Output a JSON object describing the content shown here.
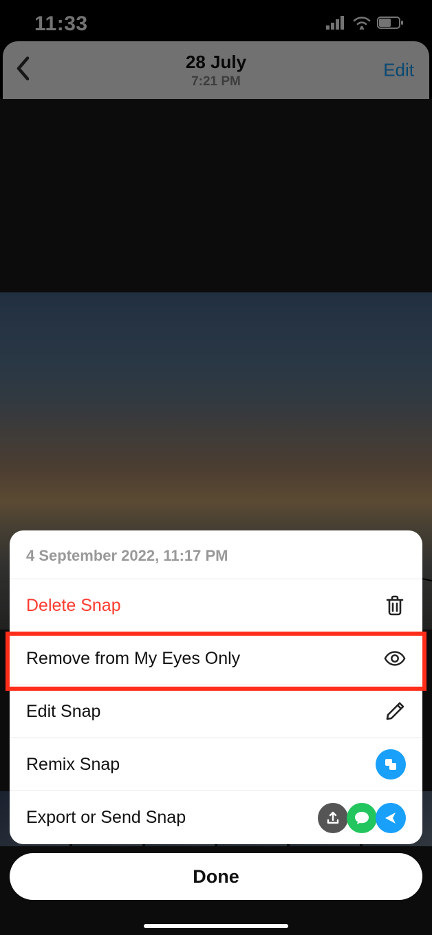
{
  "statusbar": {
    "time": "11:33"
  },
  "header": {
    "date": "28 July",
    "time": "7:21 PM",
    "edit": "Edit"
  },
  "sheet": {
    "timestamp": "4 September 2022, 11:17 PM",
    "rows": {
      "delete": {
        "label": "Delete Snap"
      },
      "remove": {
        "label": "Remove from My Eyes Only"
      },
      "edit": {
        "label": "Edit Snap"
      },
      "remix": {
        "label": "Remix Snap"
      },
      "export": {
        "label": "Export or Send Snap"
      }
    }
  },
  "done": {
    "label": "Done"
  },
  "highlight": {
    "target": "remove-from-my-eyes-only-row"
  }
}
